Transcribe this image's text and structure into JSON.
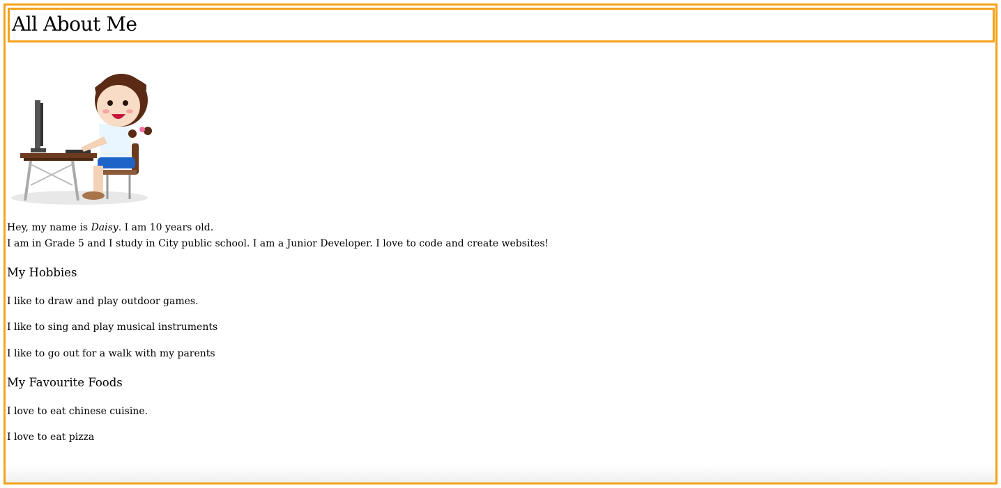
{
  "header": {
    "title": "All About Me"
  },
  "intro": {
    "line1_prefix": "Hey, my name is ",
    "name": "Daisy",
    "line1_suffix": ". I am 10 years old.",
    "line2": "I am in Grade 5 and I study in City public school. I am a Junior Developer. I love to code and create websites!"
  },
  "hobbies": {
    "heading": "My Hobbies",
    "items": [
      "I like to draw and play outdoor games.",
      "I like to sing and play musical instruments",
      "I like to go out for a walk with my parents"
    ]
  },
  "foods": {
    "heading": "My Favourite Foods",
    "items": [
      "I love to eat chinese cuisine.",
      "I love to eat pizza"
    ]
  },
  "colors": {
    "border": "#f5a21b"
  }
}
